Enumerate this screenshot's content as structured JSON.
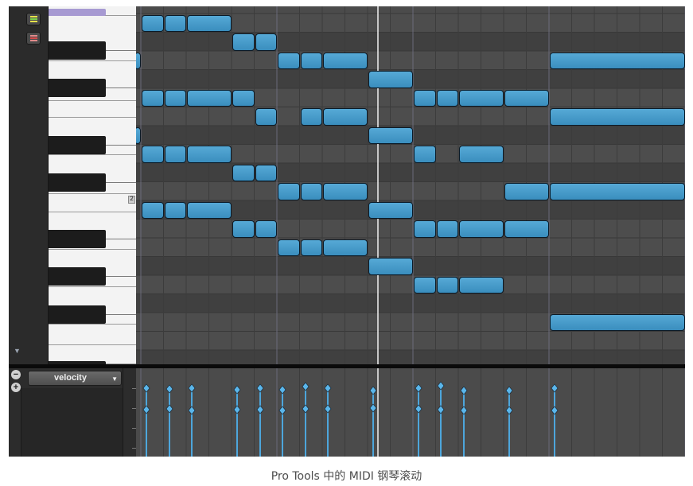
{
  "caption": "Pro Tools 中的 MIDI 钢琴滚动",
  "colors": {
    "note_fill": "#3f97c7",
    "note_border": "#0b1b28",
    "grid_bg": "#4b4b4b",
    "selected_key": "#a79ad2",
    "velocity_stem": "#4da6dc",
    "playhead": "#f2f2f2"
  },
  "toolbar": {
    "buttons": [
      {
        "name": "note-view-toggle-button",
        "icon": "green-lines-icon"
      },
      {
        "name": "note-delete-toggle-button",
        "icon": "red-lines-icon"
      }
    ]
  },
  "keyboard": {
    "octave_label": "2",
    "selected_key": "lavender-highlight"
  },
  "controller_lane": {
    "selected": "velocity",
    "remove_lane_icon": "minus-circle-icon",
    "add_lane_icon": "plus-circle-icon"
  },
  "note_count": 60
}
